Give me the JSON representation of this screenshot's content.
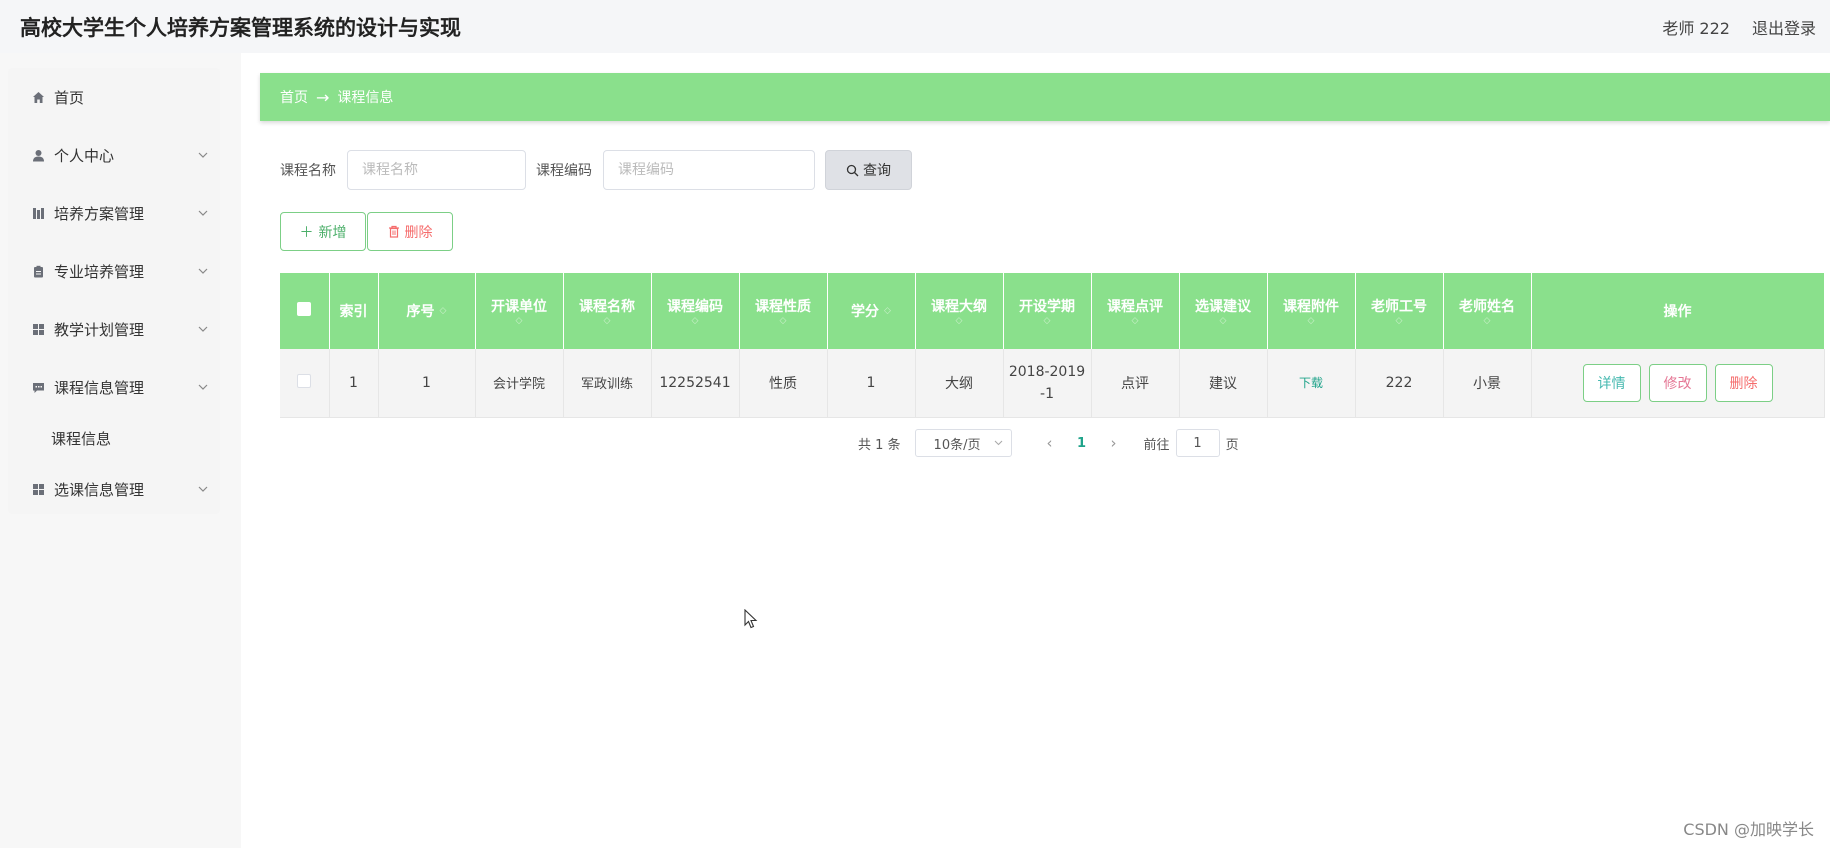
{
  "header": {
    "title": "高校大学生个人培养方案管理系统的设计与实现",
    "user": "老师 222",
    "logout": "退出登录"
  },
  "sidebar": {
    "items": [
      {
        "label": "首页",
        "icon": "home-icon",
        "has_children": false
      },
      {
        "label": "个人中心",
        "icon": "user-icon",
        "has_children": true
      },
      {
        "label": "培养方案管理",
        "icon": "books-icon",
        "has_children": true
      },
      {
        "label": "专业培养管理",
        "icon": "clipboard-icon",
        "has_children": true
      },
      {
        "label": "教学计划管理",
        "icon": "grid-icon",
        "has_children": true
      },
      {
        "label": "课程信息管理",
        "icon": "chat-icon",
        "has_children": true
      },
      {
        "label": "选课信息管理",
        "icon": "grid-icon",
        "has_children": true
      }
    ],
    "sub_item": "课程信息"
  },
  "breadcrumb": {
    "home": "首页",
    "arrow": "→",
    "current": "课程信息"
  },
  "search": {
    "name_label": "课程名称",
    "name_placeholder": "课程名称",
    "code_label": "课程编码",
    "code_placeholder": "课程编码",
    "query_button": "查询"
  },
  "actions": {
    "add": "新增",
    "delete": "删除"
  },
  "table": {
    "columns": [
      "索引",
      "序号",
      "开课单位",
      "课程名称",
      "课程编码",
      "课程性质",
      "学分",
      "课程大纲",
      "开设学期",
      "课程点评",
      "选课建议",
      "课程附件",
      "老师工号",
      "老师姓名",
      "操作"
    ],
    "rows": [
      {
        "index": "1",
        "seq": "1",
        "unit": "会计学院",
        "course_name": "军政训练",
        "course_code": "12252541",
        "nature": "性质",
        "credit": "1",
        "outline": "大纲",
        "semester": "2018-2019-1",
        "review": "点评",
        "advice": "建议",
        "attachment": "下载",
        "teacher_id": "222",
        "teacher_name": "小景",
        "ops": {
          "detail": "详情",
          "edit": "修改",
          "delete": "删除"
        }
      }
    ]
  },
  "pagination": {
    "total": "共 1 条",
    "page_size": "10条/页",
    "current_page": "1",
    "goto_label": "前往",
    "goto_value": "1",
    "page_suffix": "页"
  },
  "watermark": "CSDN @加映学长",
  "colors": {
    "accent_green": "#8ae08c",
    "link_teal": "#1fa38a",
    "danger": "#f56c6c"
  }
}
